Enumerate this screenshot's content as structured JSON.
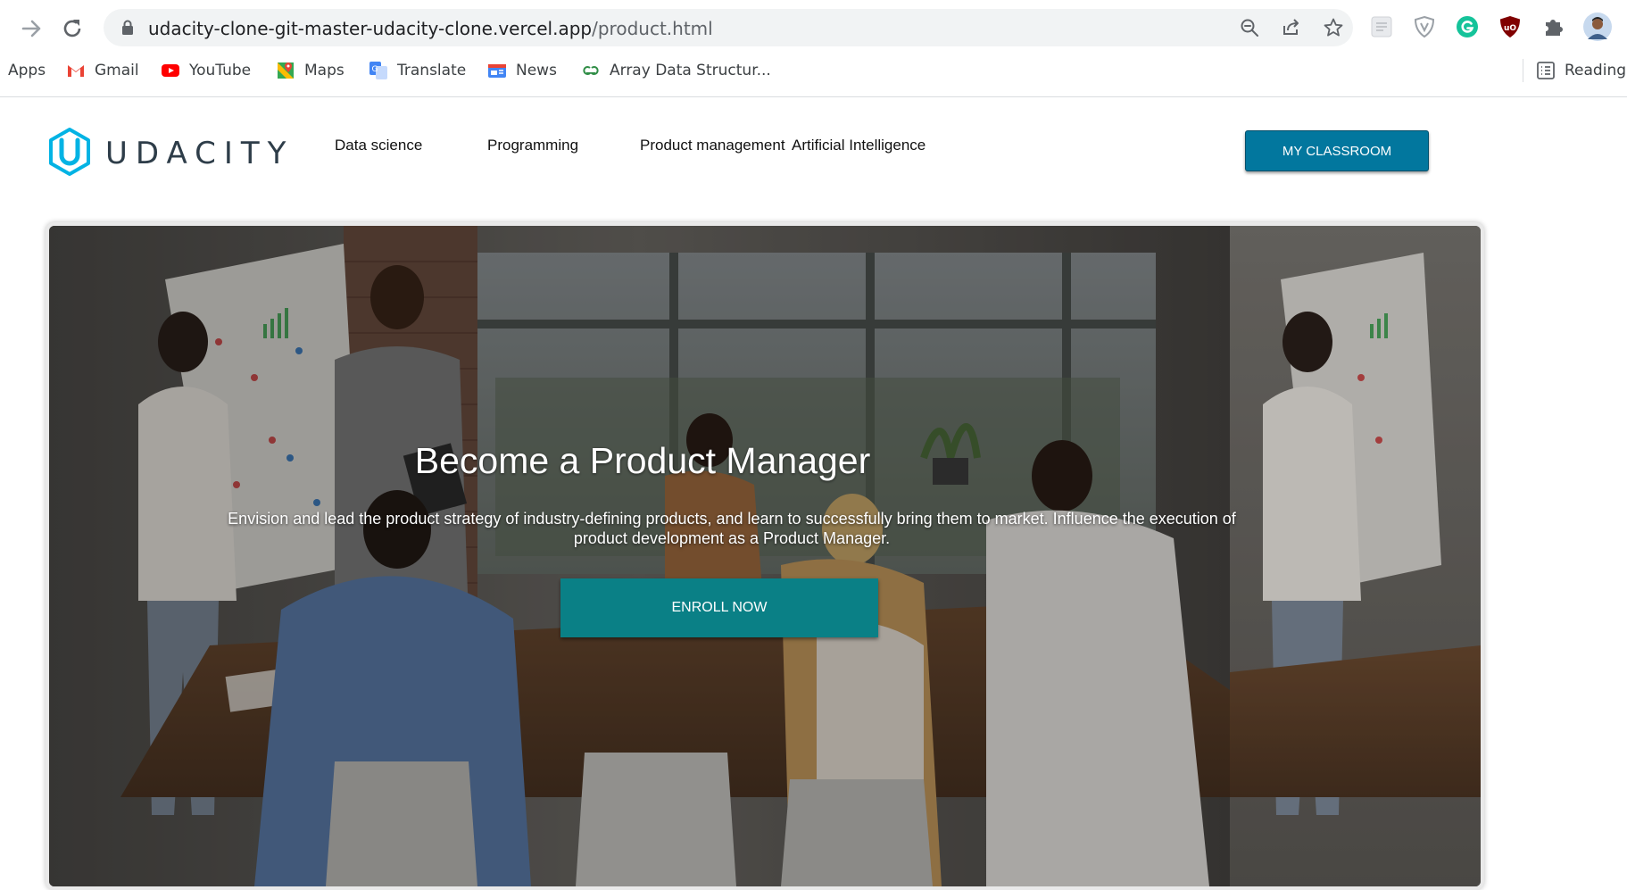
{
  "browser": {
    "url_host": "udacity-clone-git-master-udacity-clone.vercel.app",
    "url_path": "/product.html",
    "icons": [
      "forward-arrow-icon",
      "reload-icon",
      "lock-icon",
      "zoom-icon",
      "share-icon",
      "star-icon",
      "extension-icon",
      "shield-icon",
      "grammarly-icon",
      "ublock-icon",
      "puzzle-icon",
      "profile-avatar"
    ],
    "bookmarks": [
      "Apps",
      "Gmail",
      "YouTube",
      "Maps",
      "Translate",
      "News",
      "Array Data Structur..."
    ],
    "reading_list": "Reading"
  },
  "site": {
    "logo_text": "UDACITY",
    "nav": [
      "Data science",
      "Programming",
      "Product management",
      "Artificial Intelligence"
    ],
    "classroom_label": "MY CLASSROOM"
  },
  "hero": {
    "title": "Become a Product Manager",
    "description": "Envision and lead the product strategy of industry-defining products, and learn to successfully bring them to market. Influence the execution of product development as a Product Manager.",
    "cta_label": "ENROLL NOW"
  },
  "colors": {
    "brand": "#02b3e4",
    "classroom_button": "#02779e",
    "enroll_button": "#0a8086"
  }
}
